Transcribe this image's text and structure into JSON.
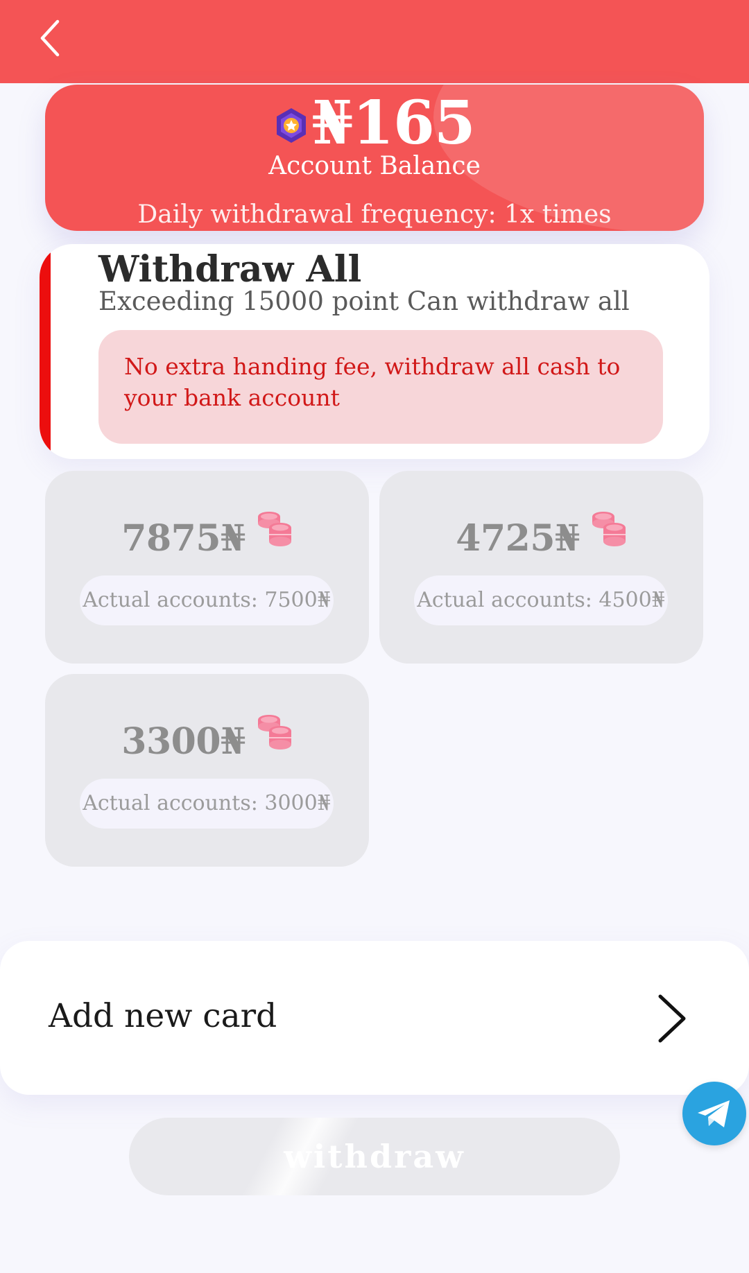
{
  "balance": {
    "amount": "₦165",
    "label": "Account Balance",
    "frequency": "Daily withdrawal frequency: 1x times"
  },
  "withdraw_all": {
    "title": "Withdraw All",
    "subtitle": "Exceeding 15000 point Can withdraw all",
    "note": "No extra handing fee, withdraw all cash to your bank account"
  },
  "options": [
    {
      "amount": "7875₦",
      "actual": "Actual accounts: 7500₦"
    },
    {
      "amount": "4725₦",
      "actual": "Actual accounts: 4500₦"
    },
    {
      "amount": "3300₦",
      "actual": "Actual accounts: 3000₦"
    }
  ],
  "add_card": {
    "label": "Add new card"
  },
  "withdraw_button": {
    "label": "withdraw"
  },
  "icons": {
    "back": "chevron-left-icon",
    "medal": "medal-icon",
    "coins": "coins-icon",
    "next": "chevron-right-icon",
    "telegram": "telegram-icon"
  },
  "colors": {
    "brand_red": "#f45455",
    "accent_red": "#ec0e0e",
    "note_text": "#d11818",
    "telegram_blue": "#2aa3e0"
  }
}
